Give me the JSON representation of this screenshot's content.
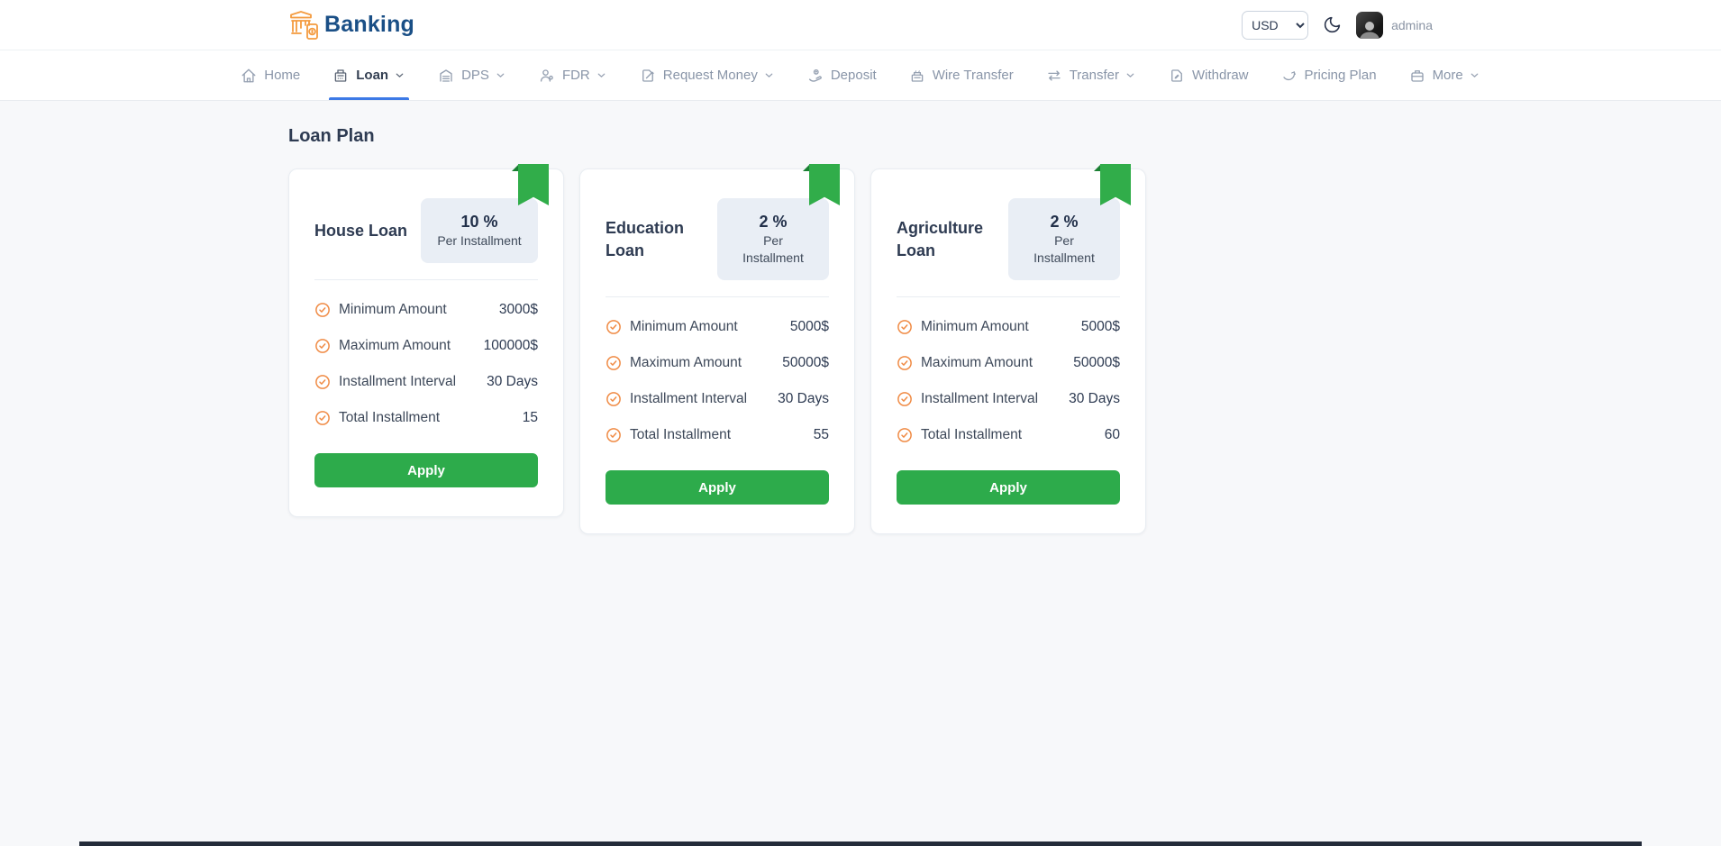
{
  "header": {
    "brand": "Banking",
    "currency": "USD",
    "username": "admina"
  },
  "nav": {
    "items": [
      {
        "label": "Home",
        "icon": "home-icon",
        "dropdown": false,
        "active": false
      },
      {
        "label": "Loan",
        "icon": "loan-icon",
        "dropdown": true,
        "active": true
      },
      {
        "label": "DPS",
        "icon": "dps-icon",
        "dropdown": true,
        "active": false
      },
      {
        "label": "FDR",
        "icon": "fdr-icon",
        "dropdown": true,
        "active": false
      },
      {
        "label": "Request Money",
        "icon": "request-money-icon",
        "dropdown": true,
        "active": false
      },
      {
        "label": "Deposit",
        "icon": "deposit-icon",
        "dropdown": false,
        "active": false
      },
      {
        "label": "Wire Transfer",
        "icon": "wire-transfer-icon",
        "dropdown": false,
        "active": false
      },
      {
        "label": "Transfer",
        "icon": "transfer-icon",
        "dropdown": true,
        "active": false
      },
      {
        "label": "Withdraw",
        "icon": "withdraw-icon",
        "dropdown": false,
        "active": false
      },
      {
        "label": "Pricing Plan",
        "icon": "pricing-plan-icon",
        "dropdown": false,
        "active": false
      },
      {
        "label": "More",
        "icon": "more-icon",
        "dropdown": true,
        "active": false
      }
    ]
  },
  "page": {
    "title": "Loan Plan"
  },
  "plans": [
    {
      "name": "House Loan",
      "rate": "10 %",
      "rate_label": "Per Installment",
      "features": [
        {
          "label": "Minimum Amount",
          "value": "3000$"
        },
        {
          "label": "Maximum Amount",
          "value": "100000$"
        },
        {
          "label": "Installment Interval",
          "value": "30 Days"
        },
        {
          "label": "Total Installment",
          "value": "15"
        }
      ],
      "apply_label": "Apply"
    },
    {
      "name": "Education Loan",
      "rate": "2 %",
      "rate_label": "Per Installment",
      "features": [
        {
          "label": "Minimum Amount",
          "value": "5000$"
        },
        {
          "label": "Maximum Amount",
          "value": "50000$"
        },
        {
          "label": "Installment Interval",
          "value": "30 Days"
        },
        {
          "label": "Total Installment",
          "value": "55"
        }
      ],
      "apply_label": "Apply"
    },
    {
      "name": "Agriculture Loan",
      "rate": "2 %",
      "rate_label": "Per Installment",
      "features": [
        {
          "label": "Minimum Amount",
          "value": "5000$"
        },
        {
          "label": "Maximum Amount",
          "value": "50000$"
        },
        {
          "label": "Installment Interval",
          "value": "30 Days"
        },
        {
          "label": "Total Installment",
          "value": "60"
        }
      ],
      "apply_label": "Apply"
    }
  ],
  "colors": {
    "accent_green": "#2dab4b",
    "ribbon_green": "#31ad4a",
    "check_orange": "#f08b45",
    "brand_blue": "#1a4f86",
    "logo_orange": "#f49b3f",
    "active_underline_blue": "#3c79e6",
    "badge_bg": "#e9eef5"
  }
}
